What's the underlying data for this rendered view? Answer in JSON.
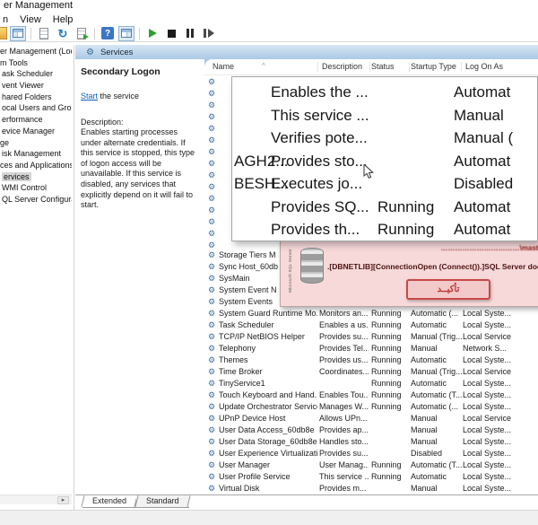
{
  "window": {
    "title": "er Management"
  },
  "menu": {
    "items": [
      "n",
      "View",
      "Help"
    ]
  },
  "icons": {
    "refresh_glyph": "↻",
    "help_glyph": "?",
    "gear_glyph": "⚙",
    "sort_caret": "^",
    "tree_scroll_right": "▸",
    "service_gear": "⚙"
  },
  "tree": {
    "items": [
      {
        "label": "er Management (Local",
        "indent": 0,
        "selected": false
      },
      {
        "label": "m Tools",
        "indent": 0,
        "selected": false
      },
      {
        "label": "ask Scheduler",
        "indent": 2,
        "selected": false
      },
      {
        "label": "vent Viewer",
        "indent": 2,
        "selected": false
      },
      {
        "label": "hared Folders",
        "indent": 2,
        "selected": false
      },
      {
        "label": "ocal Users and Groups",
        "indent": 2,
        "selected": false
      },
      {
        "label": "erformance",
        "indent": 2,
        "selected": false
      },
      {
        "label": "evice Manager",
        "indent": 2,
        "selected": false
      },
      {
        "label": "ge",
        "indent": 0,
        "selected": false
      },
      {
        "label": "isk Management",
        "indent": 2,
        "selected": false
      },
      {
        "label": "ces and Applications",
        "indent": 0,
        "selected": false
      },
      {
        "label": "ervices",
        "indent": 2,
        "selected": true
      },
      {
        "label": "WMI Control",
        "indent": 2,
        "selected": false
      },
      {
        "label": "QL Server Configuratio",
        "indent": 2,
        "selected": false
      }
    ]
  },
  "caption": {
    "title": "Services"
  },
  "pane": {
    "service_name": "Secondary Logon",
    "action_link": "Start",
    "action_rest": " the service",
    "desc_label": "Description:",
    "desc": "Enables starting processes under alternate credentials. If this service is stopped, this type of logon access will be unavailable. If this service is disabled, any services that explicitly depend on it will fail to start.",
    "tabs": [
      {
        "label": "Extended",
        "active": true
      },
      {
        "label": "Standard",
        "active": false
      }
    ]
  },
  "list": {
    "columns": {
      "name": "Name",
      "description": "Description",
      "status": "Status",
      "startup": "Startup Type",
      "logon": "Log On As"
    },
    "masked_rows": [
      {},
      {},
      {},
      {},
      {},
      {},
      {},
      {},
      {},
      {},
      {},
      {},
      {},
      {},
      {}
    ],
    "rows_behind_dialog": [
      {
        "name": "Storage Tiers M"
      },
      {
        "name": "Sync Host_60db"
      },
      {
        "name": "SysMain"
      },
      {
        "name": "System Event N"
      },
      {
        "name": "System Events"
      }
    ],
    "rows": [
      {
        "name": "System Guard Runtime Mo...",
        "description": "Monitors an...",
        "status": "Running",
        "startup": "Automatic (...",
        "logon": "Local Syste..."
      },
      {
        "name": "Task Scheduler",
        "description": "Enables a us...",
        "status": "Running",
        "startup": "Automatic",
        "logon": "Local Syste..."
      },
      {
        "name": "TCP/IP NetBIOS Helper",
        "description": "Provides su...",
        "status": "Running",
        "startup": "Manual (Trig...",
        "logon": "Local Service"
      },
      {
        "name": "Telephony",
        "description": "Provides Tel...",
        "status": "Running",
        "startup": "Manual",
        "logon": "Network S..."
      },
      {
        "name": "Themes",
        "description": "Provides us...",
        "status": "Running",
        "startup": "Automatic",
        "logon": "Local Syste..."
      },
      {
        "name": "Time Broker",
        "description": "Coordinates...",
        "status": "Running",
        "startup": "Manual (Trig...",
        "logon": "Local Service"
      },
      {
        "name": "TinyService1",
        "description": "",
        "status": "Running",
        "startup": "Automatic",
        "logon": "Local Syste..."
      },
      {
        "name": "Touch Keyboard and Hand...",
        "description": "Enables Tou...",
        "status": "Running",
        "startup": "Automatic (T...",
        "logon": "Local Syste..."
      },
      {
        "name": "Update Orchestrator Service",
        "description": "Manages W...",
        "status": "Running",
        "startup": "Automatic (...",
        "logon": "Local Syste..."
      },
      {
        "name": "UPnP Device Host",
        "description": "Allows UPn...",
        "status": "",
        "startup": "Manual",
        "logon": "Local Service"
      },
      {
        "name": "User Data Access_60db8e",
        "description": "Provides ap...",
        "status": "",
        "startup": "Manual",
        "logon": "Local Syste..."
      },
      {
        "name": "User Data Storage_60db8e",
        "description": "Handles sto...",
        "status": "",
        "startup": "Manual",
        "logon": "Local Syste..."
      },
      {
        "name": "User Experience Virtualizati...",
        "description": "Provides su...",
        "status": "",
        "startup": "Disabled",
        "logon": "Local Syste..."
      },
      {
        "name": "User Manager",
        "description": "User Manag...",
        "status": "Running",
        "startup": "Automatic (T...",
        "logon": "Local Syste..."
      },
      {
        "name": "User Profile Service",
        "description": "This service ...",
        "status": "Running",
        "startup": "Automatic",
        "logon": "Local Syste..."
      },
      {
        "name": "Virtual Disk",
        "description": "Provides m...",
        "status": "",
        "startup": "Manual",
        "logon": "Local Syste..."
      }
    ]
  },
  "magnifier": {
    "rows": [
      {
        "name": "",
        "description": "Enables the ...",
        "status": "",
        "startup": "Automat"
      },
      {
        "name": "",
        "description": "This service ...",
        "status": "",
        "startup": "Manual"
      },
      {
        "name": "",
        "description": "Verifies pote...",
        "status": "",
        "startup": "Manual ("
      },
      {
        "name": "AGH2...",
        "description": "Provides sto...",
        "status": "",
        "startup": "Automat"
      },
      {
        "name": "BESH...",
        "description": "Executes jo...",
        "status": "",
        "startup": "Disabled"
      },
      {
        "name": "",
        "description": "Provides SQ...",
        "status": "Running",
        "startup": "Automat"
      },
      {
        "name": "",
        "description": "Provides th...",
        "status": "Running",
        "startup": "Automat"
      }
    ]
  },
  "dialog": {
    "icon_label": "Microsoft SQL Server",
    "connection_line": "……………………………\\master",
    "error_line": ".[DBNETLIB][ConnectionOpen (Connect()).]SQL Server does not e",
    "confirm_button": "تأكيــد"
  }
}
